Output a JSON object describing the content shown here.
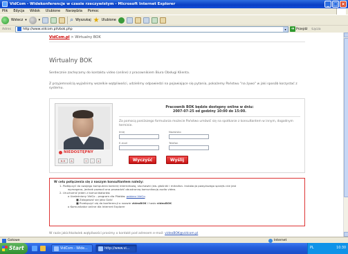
{
  "window": {
    "title": "VidCom - Widekonferencje w czasie rzeczywistym - Microsoft Internet Explorer",
    "minimize_glyph": "_",
    "maximize_glyph": "□",
    "close_glyph": "×"
  },
  "menu": [
    "Plik",
    "Edycja",
    "Widok",
    "Ulubione",
    "Narzędzia",
    "Pomoc"
  ],
  "toolbar": {
    "back_label": "Wstecz",
    "search_label": "Wyszukaj",
    "favorites_label": "Ulubione",
    "dropdown_glyph": "▾"
  },
  "address": {
    "label": "Adres",
    "url": "http://www.vidcom.pl/vbok.php",
    "go_label": "Przejdź",
    "go_glyph": "➜",
    "links_label": "Łącza"
  },
  "page": {
    "breadcrumb_site": "VidCom.pl",
    "breadcrumb_rest": " > Wirtualny BOK",
    "title": "Wirtualny BOK",
    "intro1": "Serdecznie zachęcamy do kontaktu video (online) z pracownikiem Biura Obsługi Klienta.",
    "intro2": "Z przyjemnością wyjaśnimy wszelkie wątpliwości, udzielimy odpowiedzi na pojawiające się pytania, pokażemy Państwu \"na żywo\" w jaki sposób korzystać z systemu.",
    "status_label": "NIEDOSTĘPNY",
    "controls": [
      "B-R",
      "A",
      "+",
      "-",
      "x"
    ],
    "hours_line1": "Pracownik BOK będzie dostępny online w dniu:",
    "hours_line2": "2007-07-25 od godziny 10:00 do 15:00.",
    "form_desc": "Za pomocą poniższego formularza możecie Państwo umówić się na spotkanie z konsultantem w innym, dogodnym terminie.",
    "fields": {
      "name": "Imię",
      "surname": "Nazwisko",
      "email": "E-mail",
      "phone": "Telefon"
    },
    "submit_label": "Wyczyść",
    "send_label": "Wyślij",
    "info_title": "W celu połączenia się z naszym konsultantem należy:",
    "info_1": "1.   Podłączyć do swojego komputera kamerę internetową, słuchawki (ew. głośniki i mikrofon. Instalacja powyższego sprzętu nie jest",
    "info_1b": "wymagana, jednak pozwoli ona prowadzić obustronną komunikację audio video.",
    "info_2": "2.   Uruchomić jeden z komunikatorów:",
    "info_2a_pre": "o  Uzależniony VidCo - program dla Pilotów: ",
    "info_2a_link": "pobierz VidCo",
    "info_2a_post": ".",
    "info_2a1": "■  Zalogować się jako Gość",
    "info_2a2_pre": "■  Przełączyć się do konferencji o nazwie ",
    "info_2a2_bold1": "videoBOK",
    "info_2a2_mid": " i hasło ",
    "info_2a2_bold2": "videoBOK",
    "info_2b": "o  Komunikator online dla Internet Explorer",
    "footer_pre": "W razie jakichkolwiek wątpliwości prosimy o kontakt pod adresem e-mail: ",
    "footer_email": "videoBOK@vidcom.pl"
  },
  "statusbar": {
    "left": "Gotowe",
    "right": "Internet"
  },
  "taskbar": {
    "start_label": "Start",
    "tasks": [
      "VidCom - Wide...",
      "http://www.vi..."
    ],
    "tray_text": "PL",
    "clock": "10:30"
  },
  "colors": {
    "accent_red": "#d33",
    "link_blue": "#2a4fb0",
    "xp_blue": "#245edb"
  }
}
